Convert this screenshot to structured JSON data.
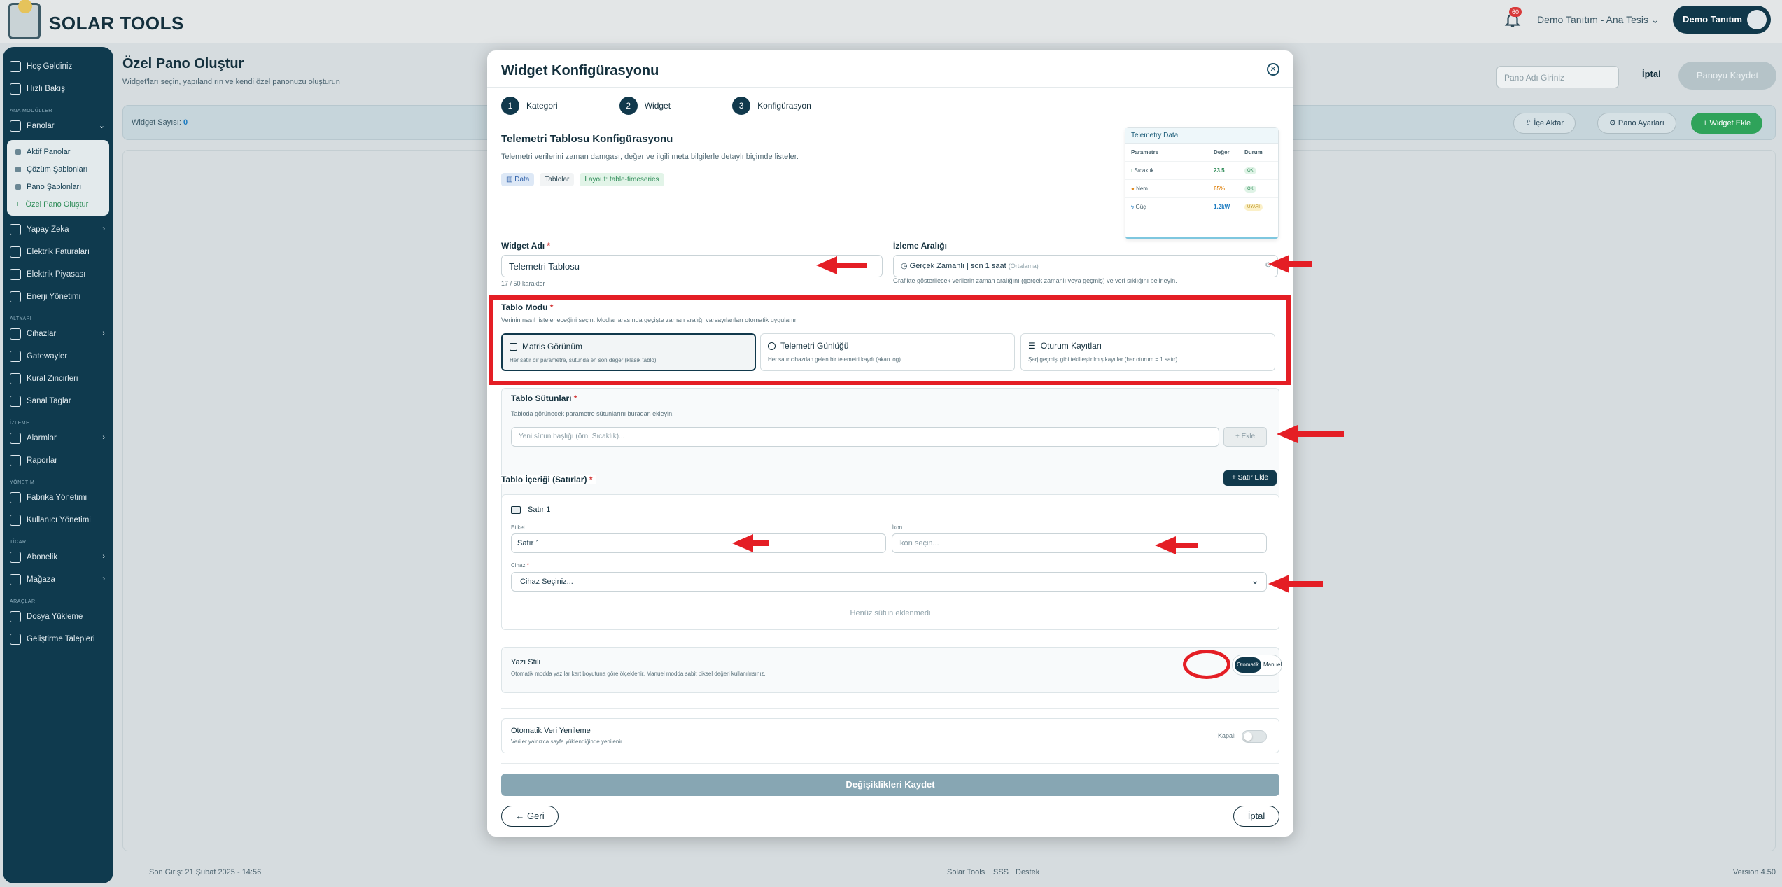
{
  "app": {
    "name": "SOLAR TOOLS",
    "notifications": "60",
    "tenant": "Demo Tanıtım - Ana Tesis",
    "user": "Demo Tanıtım"
  },
  "sidebar": {
    "top": [
      {
        "label": "Hoş Geldiniz"
      },
      {
        "label": "Hızlı Bakış"
      }
    ],
    "sec1": "ANA MODÜLLER",
    "panolar": "Panolar",
    "sub": [
      "Aktif Panolar",
      "Çözüm Şablonları",
      "Pano Şablonları",
      "Özel Pano Oluştur"
    ],
    "mid": [
      "Yapay Zeka",
      "Elektrik Faturaları",
      "Elektrik Piyasası",
      "Enerji Yönetimi"
    ],
    "sec2": "ALTYAPI",
    "infra": [
      "Cihazlar",
      "Gatewayler",
      "Kural Zincirleri",
      "Sanal Taglar"
    ],
    "sec3": "İZLEME",
    "monitor": [
      "Alarmlar",
      "Raporlar"
    ],
    "sec4": "YÖNETİM",
    "admin": [
      "Fabrika Yönetimi",
      "Kullanıcı Yönetimi"
    ],
    "sec5": "TİCARİ",
    "commerce": [
      "Abonelik",
      "Mağaza"
    ],
    "sec6": "ARAÇLAR",
    "tools": [
      "Dosya Yükleme",
      "Geliştirme Talepleri"
    ]
  },
  "page": {
    "title": "Özel Pano Oluştur",
    "subtitle": "Widget'ları seçin, yapılandırın ve kendi özel panonuzu oluşturun",
    "name_placeholder": "Pano Adı Giriniz",
    "cancel": "İptal",
    "save": "Panoyu Kaydet"
  },
  "widget_bar": {
    "count_label": "Widget Sayısı:",
    "count": "0",
    "import": "İçe Aktar",
    "settings": "Pano Ayarları",
    "add": "Widget Ekle"
  },
  "footer": {
    "last_login": "Son Giriş: 21 Şubat 2025 - 14:56",
    "brand": "Solar Tools",
    "faq": "SSS",
    "support": "Destek",
    "version": "Version 4.50"
  },
  "modal": {
    "title": "Widget Konfigürasyonu",
    "steps": [
      {
        "num": "1",
        "label": "Kategori"
      },
      {
        "num": "2",
        "label": "Widget"
      },
      {
        "num": "3",
        "label": "Konfigürasyon"
      }
    ],
    "section_title": "Telemetri Tablosu Konfigürasyonu",
    "section_desc": "Telemetri verilerini zaman damgası, değer ve ilgili meta bilgilerle detaylı biçimde listeler.",
    "tags": [
      "Data",
      "Tablolar",
      "Layout: table-timeseries"
    ],
    "preview": {
      "title": "Telemetry Data",
      "headers": [
        "Parametre",
        "Değer",
        "Durum"
      ],
      "rows": [
        {
          "name": "Sıcaklık",
          "value": "23.5",
          "status": "OK",
          "color": "#2f8c58"
        },
        {
          "name": "Nem",
          "value": "65%",
          "status": "OK",
          "color": "#e08a1e"
        },
        {
          "name": "Güç",
          "value": "1.2kW",
          "status": "UYARI",
          "color": "#1a7ac0"
        }
      ]
    },
    "widget_name": {
      "label": "Widget Adı",
      "value": "Telemetri Tablosu",
      "counter": "17 / 50 karakter"
    },
    "interval": {
      "label": "İzleme Aralığı",
      "main": "Gerçek Zamanlı",
      "sub": "son 1 saat",
      "mode": "(Ortalama)",
      "hint": "Grafikte gösterilecek verilerin zaman aralığını (gerçek zamanlı veya geçmiş) ve veri sıklığını belirleyin."
    },
    "table_mode": {
      "label": "Tablo Modu",
      "hint": "Verinin nasıl listeleneceğini seçin. Modlar arasında geçişte zaman aralığı varsayılanları otomatik uygulanır.",
      "options": [
        {
          "title": "Matris Görünüm",
          "desc": "Her satır bir parametre, sütunda en son değer (klasik tablo)"
        },
        {
          "title": "Telemetri Günlüğü",
          "desc": "Her satır cihazdan gelen bir telemetri kaydı (akan log)"
        },
        {
          "title": "Oturum Kayıtları",
          "desc": "Şarj geçmişi gibi tekilleştirilmiş kayıtlar (her oturum = 1 satır)"
        }
      ]
    },
    "columns": {
      "label": "Tablo Sütunları",
      "hint": "Tabloda görünecek parametre sütunlarını buradan ekleyin.",
      "placeholder": "Yeni sütun başlığı (örn: Sıcaklık)...",
      "add": "+ Ekle"
    },
    "rows": {
      "label": "Tablo İçeriği (Satırlar)",
      "add": "+ Satır Ekle",
      "row_title": "Satır 1",
      "label_caption": "Etiket",
      "label_value": "Satır 1",
      "icon_caption": "İkon",
      "icon_placeholder": "İkon seçin...",
      "device_caption": "Cihaz",
      "device_value": "Cihaz Seçiniz...",
      "empty": "Henüz sütun eklenmedi"
    },
    "text_style": {
      "label": "Yazı Stili",
      "hint": "Otomatik modda yazılar kart boyutuna göre ölçeklenir. Manuel modda sabit piksel değeri kullanılırsınız.",
      "auto": "Otomatik",
      "manual": "Manuel"
    },
    "auto_refresh": {
      "label": "Otomatik Veri Yenileme",
      "hint": "Veriler yalnızca sayfa yüklendiğinde yenilenir",
      "state": "Kapalı"
    },
    "save": "Değişiklikleri Kaydet",
    "back": "← Geri",
    "cancel": "İptal"
  }
}
